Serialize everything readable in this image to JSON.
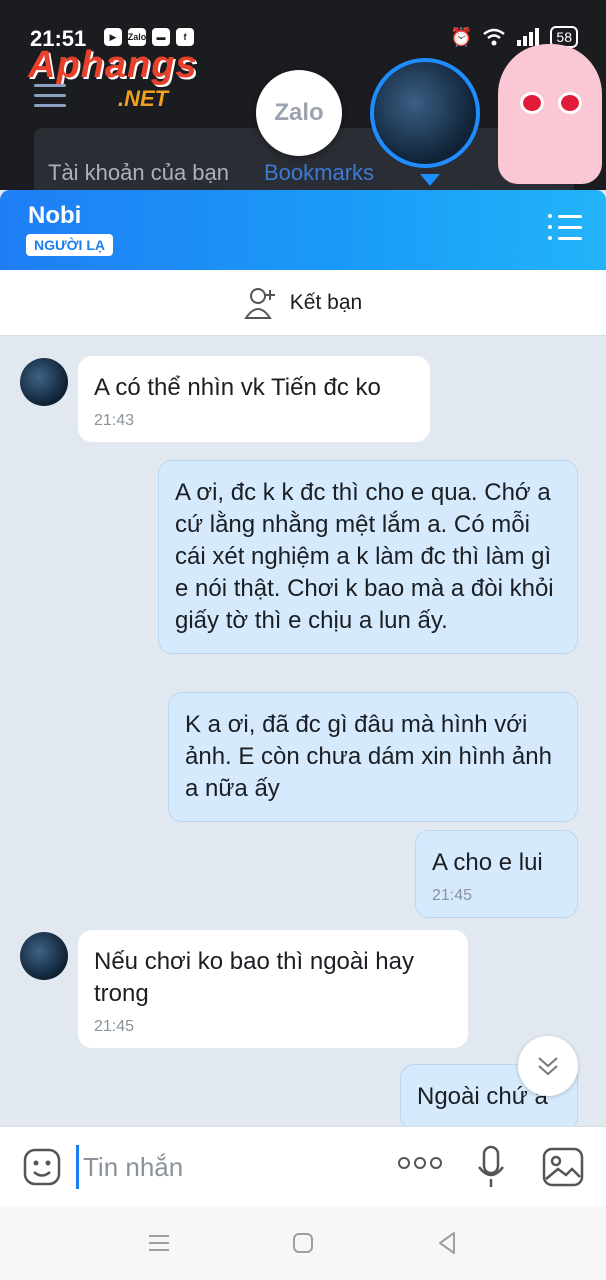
{
  "status_bar": {
    "time": "21:51",
    "apps": [
      "▶",
      "Zalo",
      "▬",
      "f"
    ],
    "battery": "58"
  },
  "browser": {
    "logo": "Aphangs",
    "logo_sub": ".NET",
    "tabs": [
      "Tài khoản của bạn",
      "Bookmarks"
    ]
  },
  "chat_heads": {
    "zalo_label": "Zalo"
  },
  "header": {
    "contact_name": "Nobi",
    "badge": "NGƯỜI LẠ"
  },
  "add_friend": {
    "label": "Kết bạn"
  },
  "messages": [
    {
      "direction": "in",
      "text": "A có thể nhìn vk Tiến đc ko",
      "time": "21:43"
    },
    {
      "direction": "out",
      "text": "A ơi, đc k k đc thì cho e qua. Chớ a cứ lằng nhằng mệt lắm a. Có mỗi cái xét nghiệm a k làm đc thì làm gì e nói thật. Chơi k bao mà a đòi khỏi giấy tờ thì e chịu a lun ấy.",
      "time": ""
    },
    {
      "direction": "out",
      "text": "K a ơi, đã đc gì đâu mà hình với ảnh. E còn chưa dám xin hình ảnh a nữa ấy",
      "time": ""
    },
    {
      "direction": "out",
      "text": "A cho e lui",
      "time": "21:45"
    },
    {
      "direction": "in",
      "text": "Nếu chơi ko bao thì ngoài hay trong",
      "time": "21:45"
    },
    {
      "direction": "out",
      "text": "Ngoài chứ a",
      "time": ""
    }
  ],
  "input": {
    "placeholder": "Tin nhắn"
  },
  "colors": {
    "header_start": "#1f7ef5",
    "header_end": "#22b4f9",
    "outgoing_bubble": "#d6eafd",
    "incoming_bubble": "#ffffff",
    "chat_background": "#e2e8ef"
  },
  "icons": {
    "menu": "list-menu-icon",
    "add_friend": "add-user-icon",
    "emoji": "sticker-smile-icon",
    "more": "more-dots-icon",
    "mic": "microphone-icon",
    "image": "image-icon",
    "scroll": "chevron-double-down-icon"
  }
}
